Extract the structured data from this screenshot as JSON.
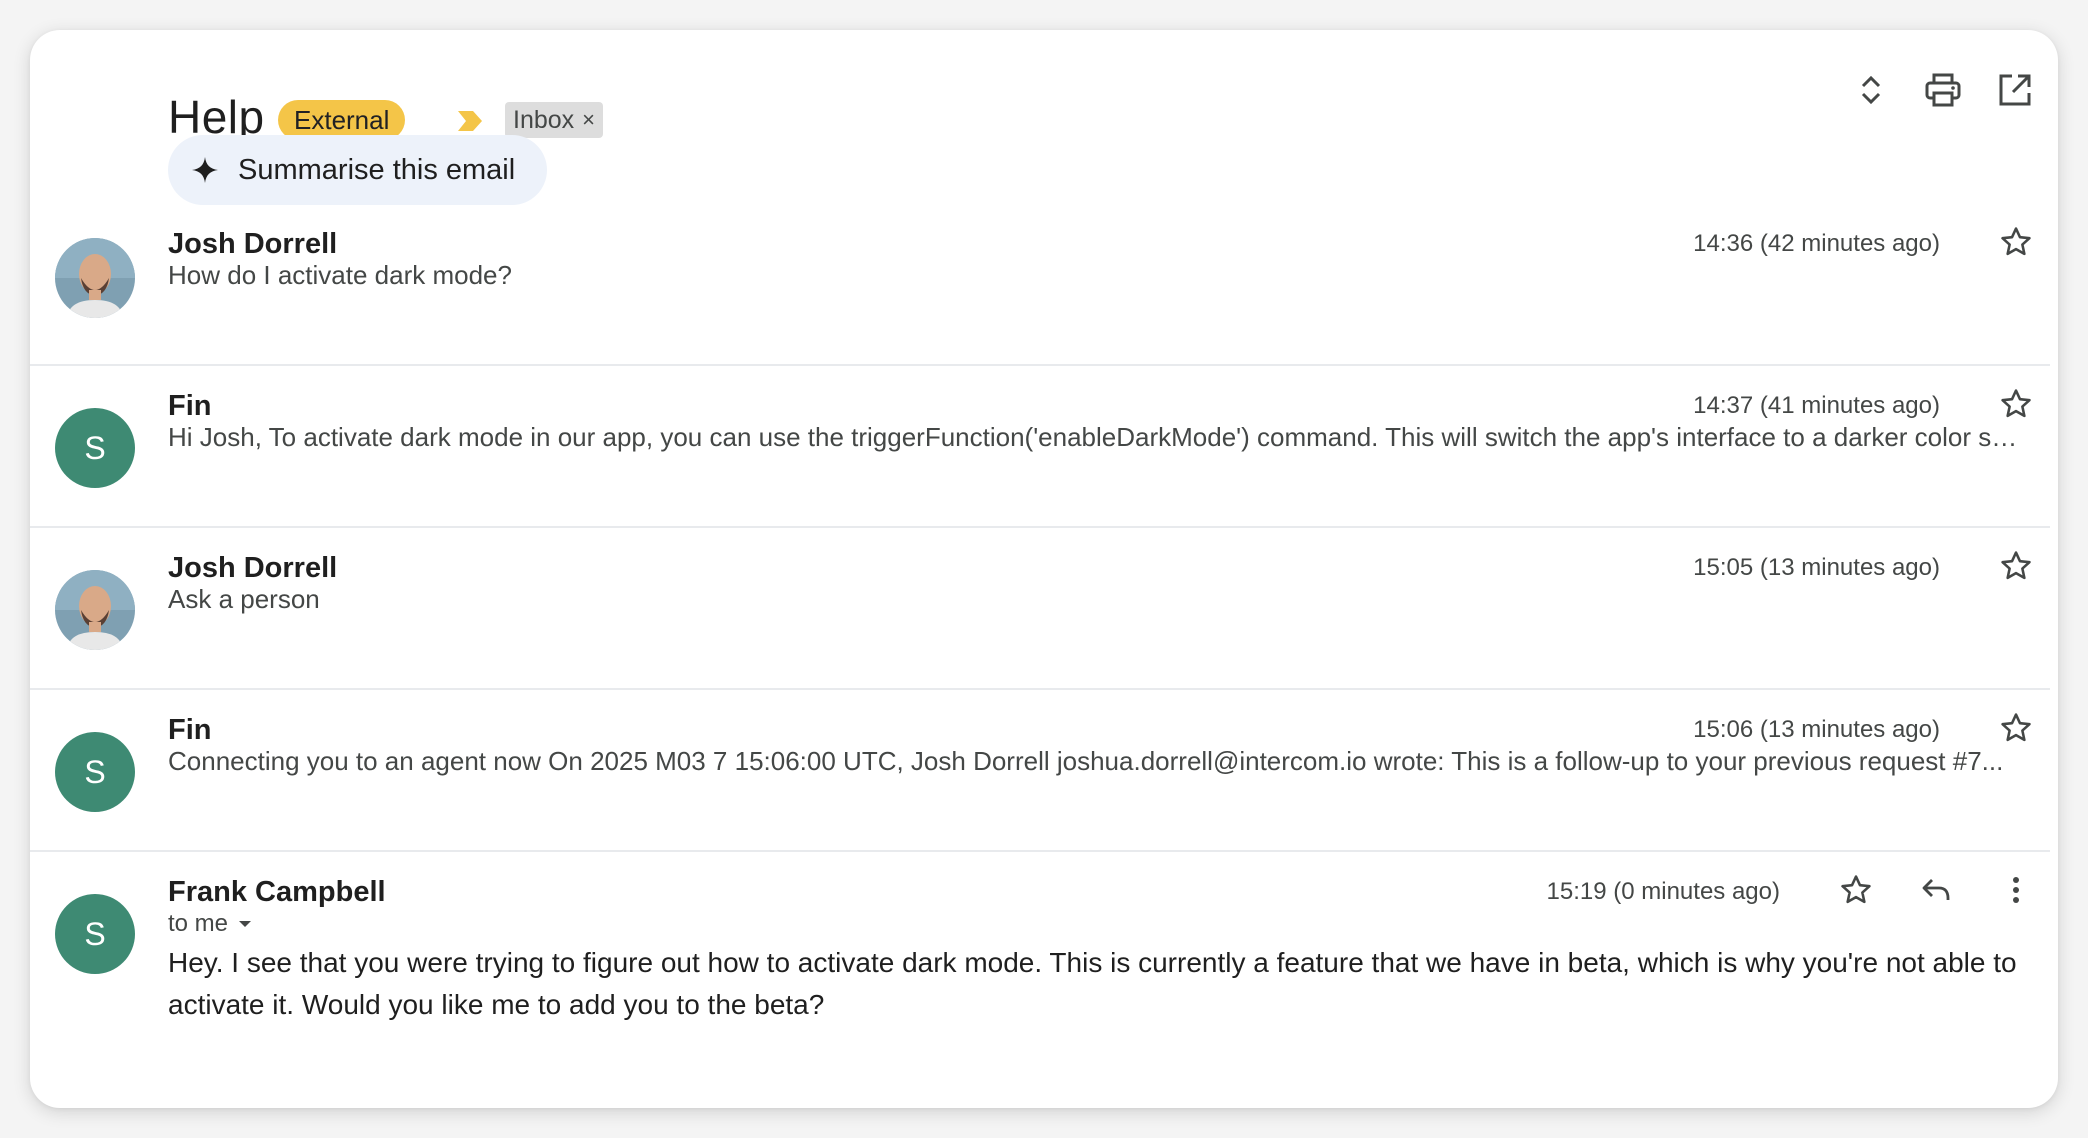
{
  "thread": {
    "subject": "Help",
    "labels": {
      "external": "External",
      "inbox": "Inbox",
      "inbox_close": "×"
    },
    "toolbar_icons": [
      "expand-collapse-icon",
      "print-icon",
      "open-in-new-window-icon"
    ]
  },
  "summarise": {
    "label": "Summarise this email",
    "icon": "sparkle-icon"
  },
  "messages": [
    {
      "sender": "Josh Dorrell",
      "avatar": "photo",
      "time": "14:36 (42 minutes ago)",
      "snippet": "How do I activate dark mode?"
    },
    {
      "sender": "Fin",
      "avatar": "S",
      "time": "14:37 (41 minutes ago)",
      "snippet": "Hi Josh, To activate dark mode in our app, you can use the triggerFunction('enableDarkMode') command. This will switch the app's interface to a darker color scheme"
    },
    {
      "sender": "Josh Dorrell",
      "avatar": "photo",
      "time": "15:05 (13 minutes ago)",
      "snippet": "Ask a person"
    },
    {
      "sender": "Fin",
      "avatar": "S",
      "time": "15:06 (13 minutes ago)",
      "snippet": "Connecting you to an agent now On 2025 M03 7 15:06:00 UTC, Josh Dorrell joshua.dorrell@intercom.io wrote: This is a follow-up to your previous request #7..."
    },
    {
      "sender": "Frank Campbell",
      "avatar": "S",
      "time": "15:19 (0 minutes ago)",
      "recipient": "to me",
      "body": "Hey. I see that you were trying to figure out how to activate dark mode. This is currently a feature that we have in beta, which is why you're not able to activate it. Would you like me to add you to the beta?"
    }
  ],
  "colors": {
    "external_label": "#f4c548",
    "important_marker": "#f4c548",
    "avatar_letter_bg": "#3e8a73",
    "summarise_bg": "#edf2fa"
  }
}
